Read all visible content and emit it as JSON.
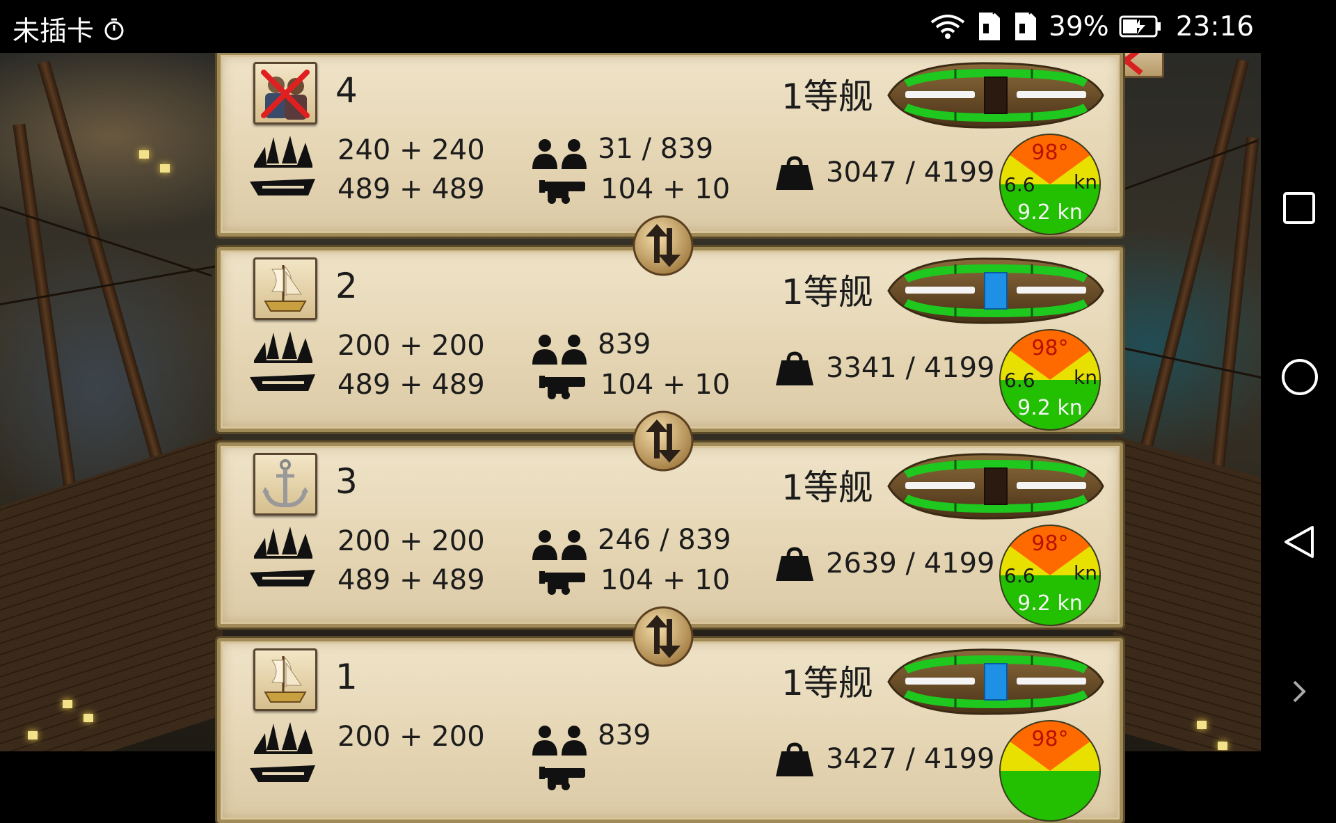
{
  "status_bar": {
    "carrier": "未插卡",
    "battery": "39%",
    "time": "23:16"
  },
  "ships": [
    {
      "number": "4",
      "class": "1等舰",
      "portrait_icon": "crossed-out-crew-icon",
      "sails": "240 + 240",
      "hull": "489 + 489",
      "crew": "31 / 839",
      "cannons": "104 + 10",
      "cargo": "3047 / 4199",
      "speed": {
        "angle": "98°",
        "left": "6.6",
        "right": "kn",
        "bottom": "9.2 kn"
      },
      "indicator_center": "dark"
    },
    {
      "number": "2",
      "class": "1等舰",
      "portrait_icon": "sailing-ship-icon",
      "sails": "200 + 200",
      "hull": "489 + 489",
      "crew": "839",
      "cannons": "104 + 10",
      "cargo": "3341 / 4199",
      "speed": {
        "angle": "98°",
        "left": "6.6",
        "right": "kn",
        "bottom": "9.2 kn"
      },
      "indicator_center": "blue"
    },
    {
      "number": "3",
      "class": "1等舰",
      "portrait_icon": "anchor-icon",
      "sails": "200 + 200",
      "hull": "489 + 489",
      "crew": "246 / 839",
      "cannons": "104 + 10",
      "cargo": "2639 / 4199",
      "speed": {
        "angle": "98°",
        "left": "6.6",
        "right": "kn",
        "bottom": "9.2 kn"
      },
      "indicator_center": "dark"
    },
    {
      "number": "1",
      "class": "1等舰",
      "portrait_icon": "sailing-ship-icon",
      "sails": "200 + 200",
      "hull": "",
      "crew": "839",
      "cannons": "",
      "cargo": "3427 / 4199",
      "speed": {
        "angle": "98°",
        "left": "",
        "right": "",
        "bottom": ""
      },
      "indicator_center": "blue"
    }
  ],
  "colors": {
    "parchment": "#e6d7b6",
    "frame": "#a08a58",
    "indicator_green": "#1ec81e",
    "indicator_blue": "#1e90e6",
    "speed_orange": "#ff6a00",
    "speed_yellow": "#e8e000",
    "speed_green": "#22c000"
  }
}
